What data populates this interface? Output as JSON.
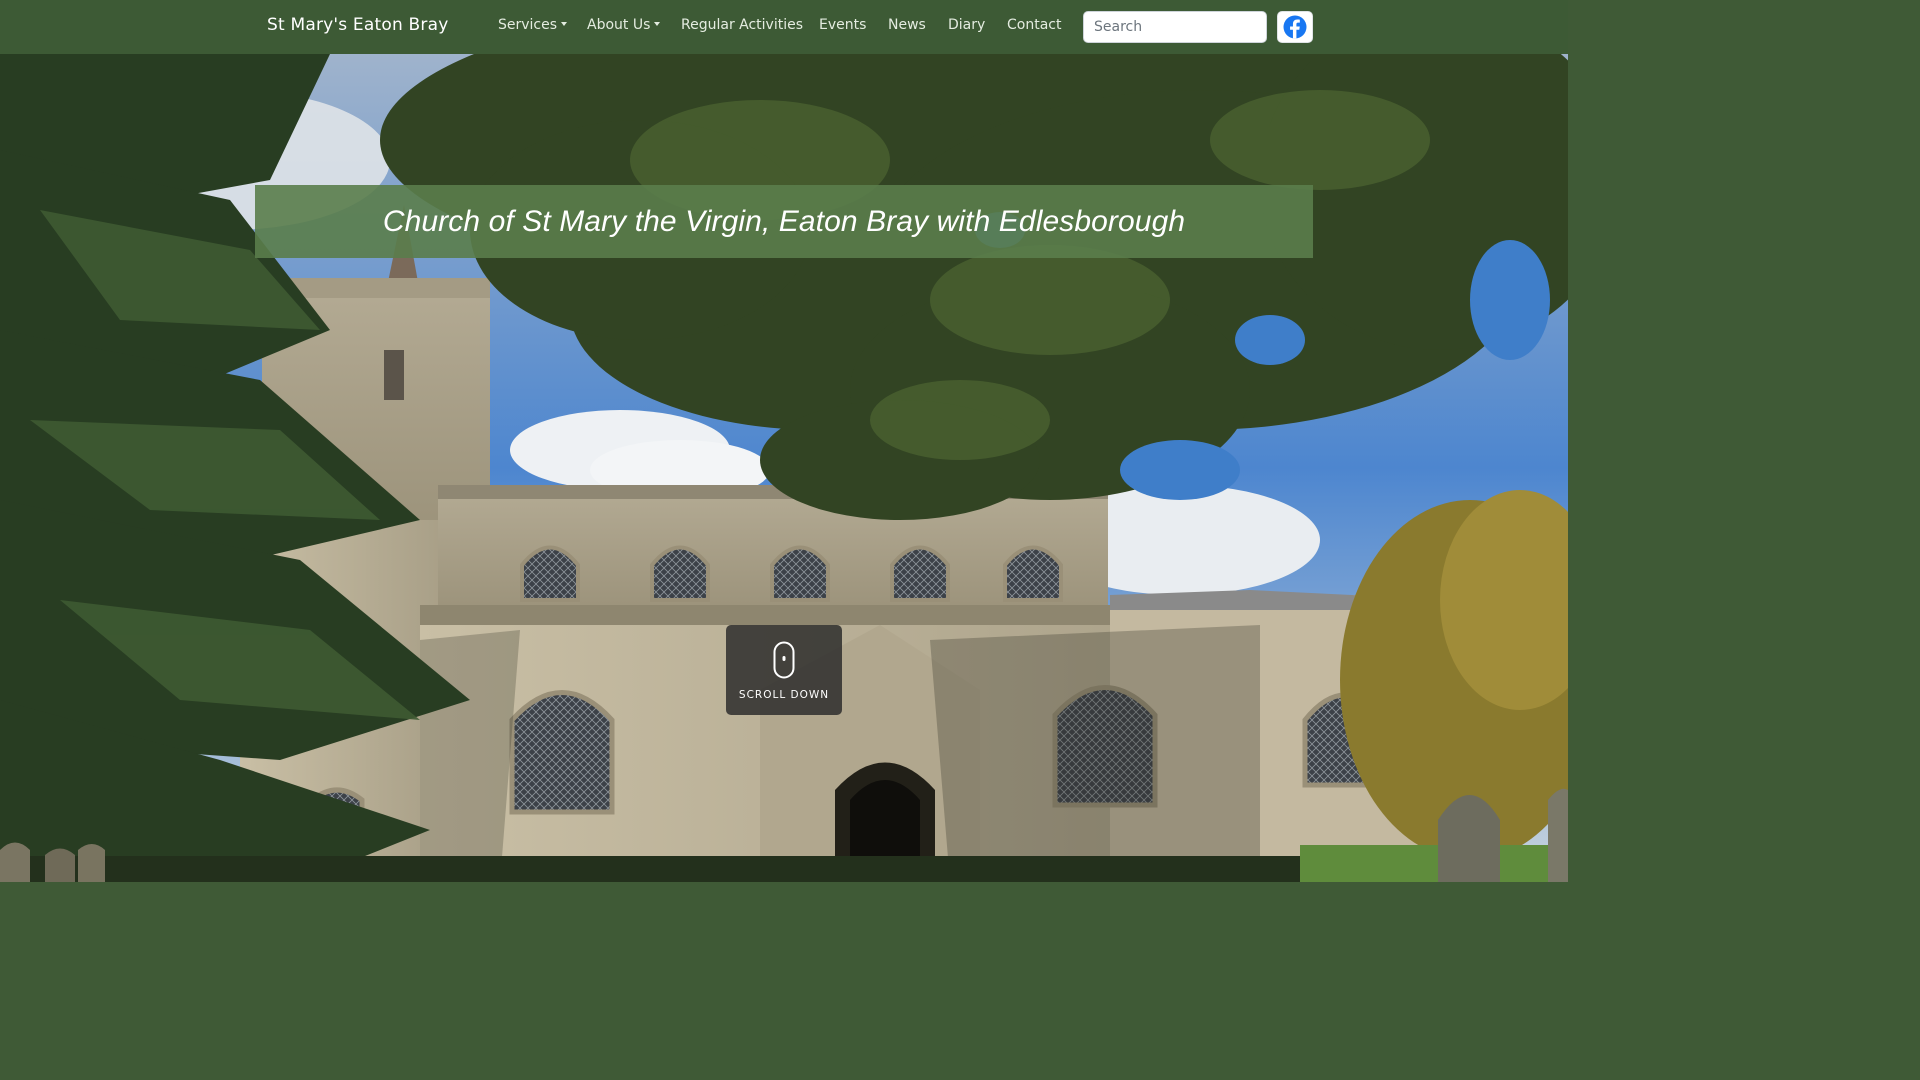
{
  "navbar": {
    "brand": "St Mary's Eaton Bray",
    "items": [
      {
        "label": "Services",
        "dropdown": true
      },
      {
        "label": "About Us",
        "dropdown": true
      },
      {
        "label": "Regular Activities",
        "dropdown": false
      },
      {
        "label": "Events",
        "dropdown": false
      },
      {
        "label": "News",
        "dropdown": false
      },
      {
        "label": "Diary",
        "dropdown": false
      },
      {
        "label": "Contact",
        "dropdown": false
      }
    ],
    "search": {
      "placeholder": "Search",
      "value": ""
    },
    "social_icon": "facebook-icon"
  },
  "hero": {
    "title": "Church of St Mary the Virgin, Eaton Bray with Edlesborough",
    "scroll_label": "SCROLL DOWN",
    "scroll_icon": "mouse-icon"
  },
  "colors": {
    "navbar_bg": "#3d5a35",
    "banner_bg": "#5a7d4b",
    "facebook_blue": "#1877f2"
  }
}
